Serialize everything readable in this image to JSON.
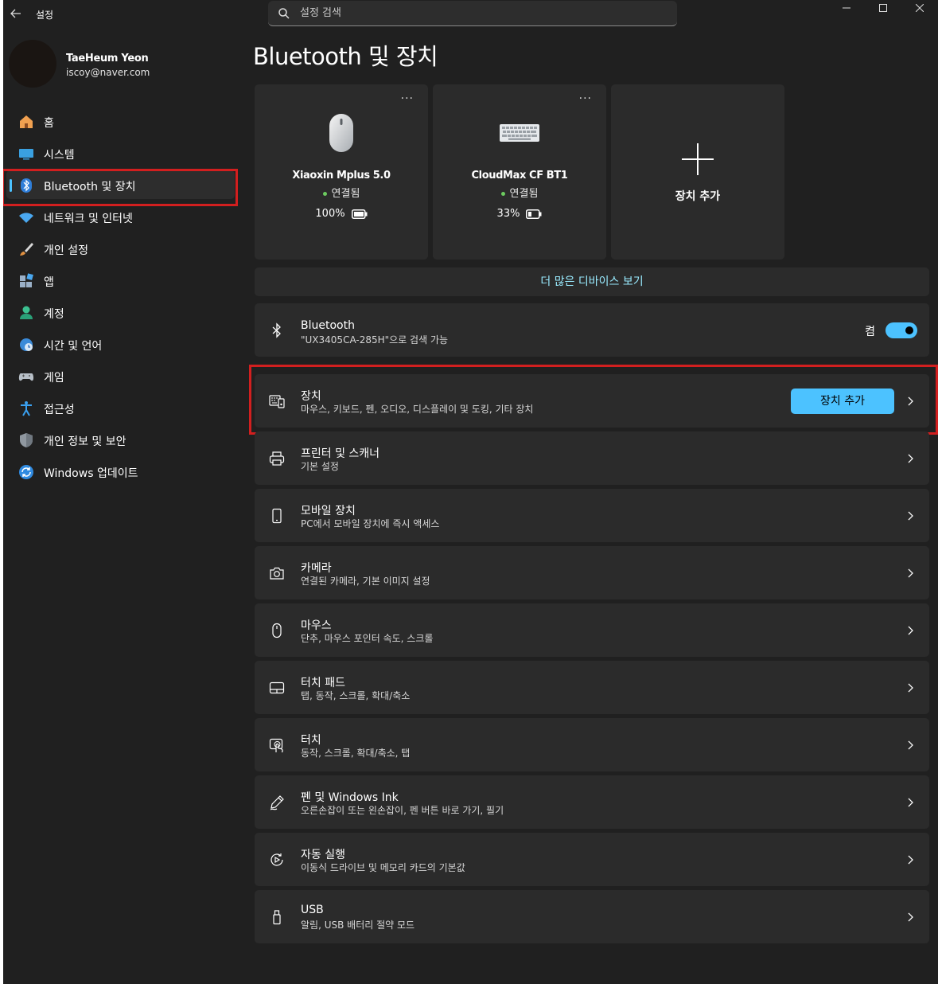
{
  "window": {
    "title": "설정",
    "minimize_icon": "minimize-icon",
    "maximize_icon": "maximize-icon",
    "close_icon": "close-icon"
  },
  "search": {
    "placeholder": "설정 검색",
    "value": ""
  },
  "profile": {
    "name": "TaeHeum Yeon",
    "email": "iscoy@naver.com"
  },
  "sidebar": {
    "items": [
      {
        "label": "홈",
        "icon": "home-icon"
      },
      {
        "label": "시스템",
        "icon": "system-icon"
      },
      {
        "label": "Bluetooth 및 장치",
        "icon": "bluetooth-icon",
        "active": true
      },
      {
        "label": "네트워크 및 인터넷",
        "icon": "wifi-icon"
      },
      {
        "label": "개인 설정",
        "icon": "brush-icon"
      },
      {
        "label": "앱",
        "icon": "apps-icon"
      },
      {
        "label": "계정",
        "icon": "account-icon"
      },
      {
        "label": "시간 및 언어",
        "icon": "time-language-icon"
      },
      {
        "label": "게임",
        "icon": "gamepad-icon"
      },
      {
        "label": "접근성",
        "icon": "accessibility-icon"
      },
      {
        "label": "개인 정보 및 보안",
        "icon": "shield-icon"
      },
      {
        "label": "Windows 업데이트",
        "icon": "update-icon"
      }
    ]
  },
  "main": {
    "title": "Bluetooth 및 장치",
    "device_cards": [
      {
        "name": "Xiaoxin Mplus 5.0",
        "status": "연결됨",
        "battery": "100%",
        "battery_level": 1.0,
        "more": "···",
        "icon": "mouse-icon"
      },
      {
        "name": "CloudMax CF BT1",
        "status": "연결됨",
        "battery": "33%",
        "battery_level": 0.33,
        "more": "···",
        "icon": "keyboard-icon"
      }
    ],
    "add_card_label": "장치 추가",
    "more_devices_link": "더 많은 디바이스 보기",
    "bluetooth": {
      "title": "Bluetooth",
      "subtitle": "\"UX3405CA-285H\"으로 검색 가능",
      "state_label": "켬",
      "on": true
    },
    "devices_row": {
      "title": "장치",
      "subtitle": "마우스, 키보드, 펜, 오디오, 디스플레이 및 도킹, 기타 장치",
      "button": "장치 추가"
    },
    "rows": [
      {
        "title": "프린터 및 스캐너",
        "subtitle": "기본 설정",
        "icon": "printer-icon"
      },
      {
        "title": "모바일 장치",
        "subtitle": "PC에서 모바일 장치에 즉시 액세스",
        "icon": "phone-icon"
      },
      {
        "title": "카메라",
        "subtitle": "연결된 카메라, 기본 이미지 설정",
        "icon": "camera-icon"
      },
      {
        "title": "마우스",
        "subtitle": "단추, 마우스 포인터 속도, 스크롤",
        "icon": "mouse-icon"
      },
      {
        "title": "터치 패드",
        "subtitle": "탭, 동작, 스크롤, 확대/축소",
        "icon": "touchpad-icon"
      },
      {
        "title": "터치",
        "subtitle": "동작, 스크롤, 확대/축소, 탭",
        "icon": "touch-icon"
      },
      {
        "title": "펜 및 Windows Ink",
        "subtitle": "오른손잡이 또는 왼손잡이, 펜 버튼 바로 가기, 필기",
        "icon": "pen-icon"
      },
      {
        "title": "자동 실행",
        "subtitle": "이동식 드라이브 및 메모리 카드의 기본값",
        "icon": "autoplay-icon"
      },
      {
        "title": "USB",
        "subtitle": "알림, USB 배터리 절약 모드",
        "icon": "usb-icon"
      }
    ]
  },
  "colors": {
    "accent": "#4cc2ff",
    "background": "#202020",
    "card": "#2b2b2b",
    "highlight": "#d21f1f",
    "link": "#99ebff"
  }
}
